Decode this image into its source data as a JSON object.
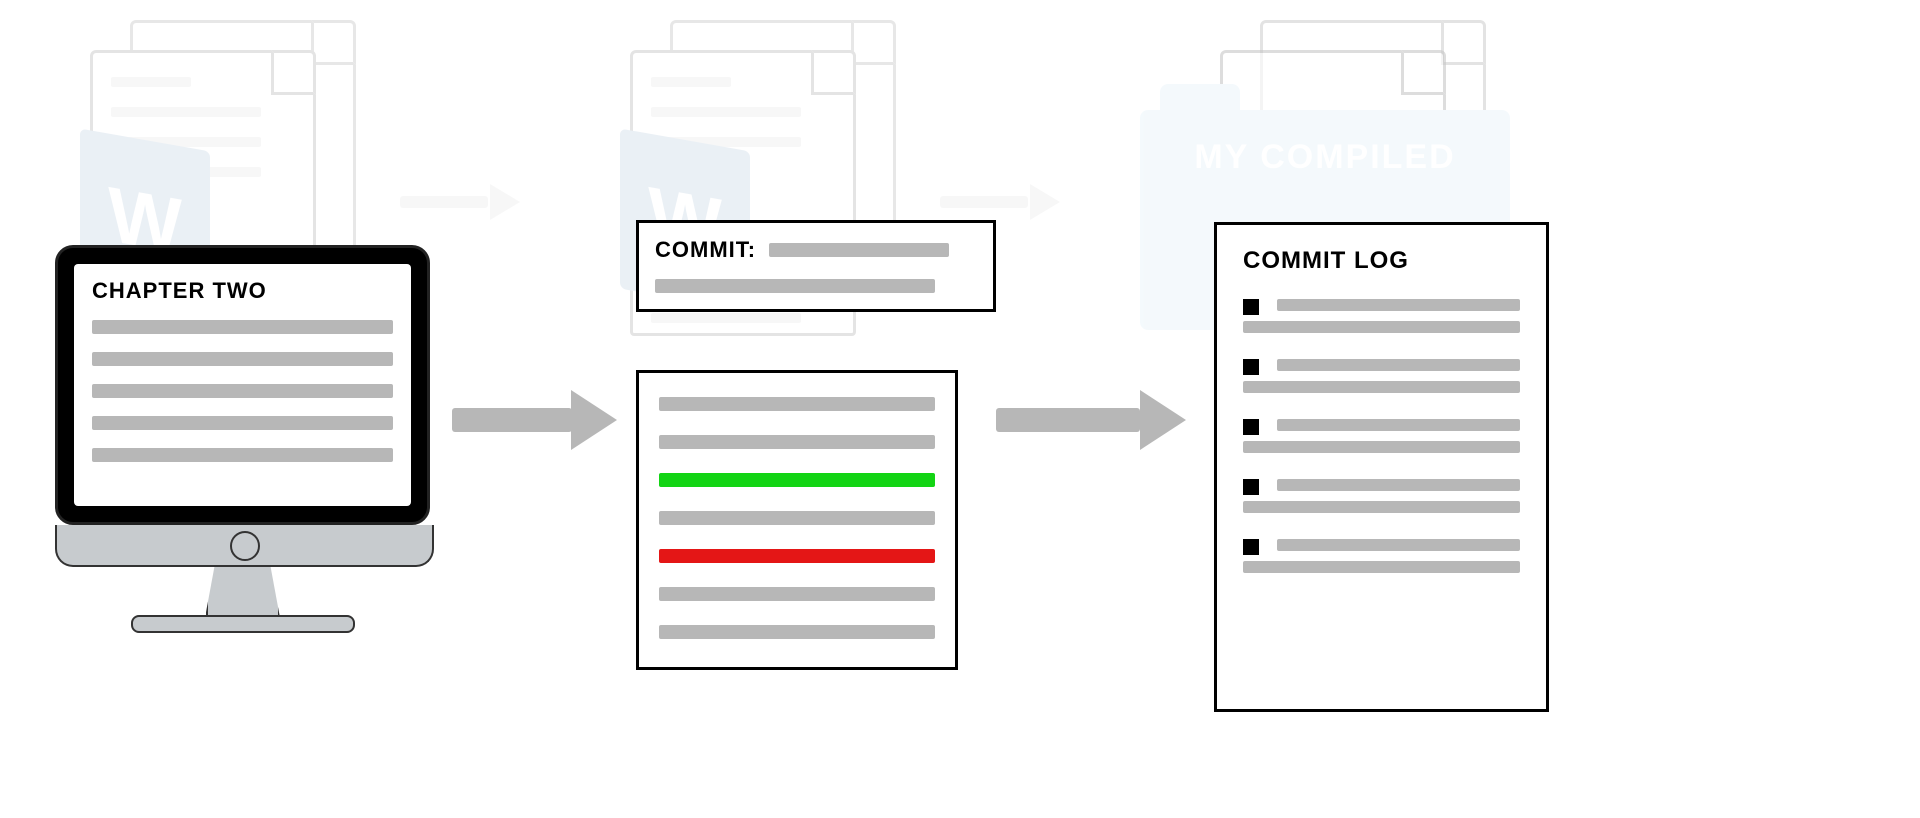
{
  "monitor": {
    "title": "CHAPTER TWO"
  },
  "commit": {
    "label": "COMMIT:"
  },
  "diff": {
    "lines": [
      {
        "kind": "context"
      },
      {
        "kind": "context"
      },
      {
        "kind": "added"
      },
      {
        "kind": "context"
      },
      {
        "kind": "removed"
      },
      {
        "kind": "context"
      },
      {
        "kind": "context"
      }
    ]
  },
  "log": {
    "title": "COMMIT LOG",
    "items": 5
  },
  "folder": {
    "label": "MY COMPILED"
  },
  "colors": {
    "added": "#13d414",
    "removed": "#e41616",
    "placeholder": "#b7b7b7",
    "folder": "#cfe8f5"
  }
}
